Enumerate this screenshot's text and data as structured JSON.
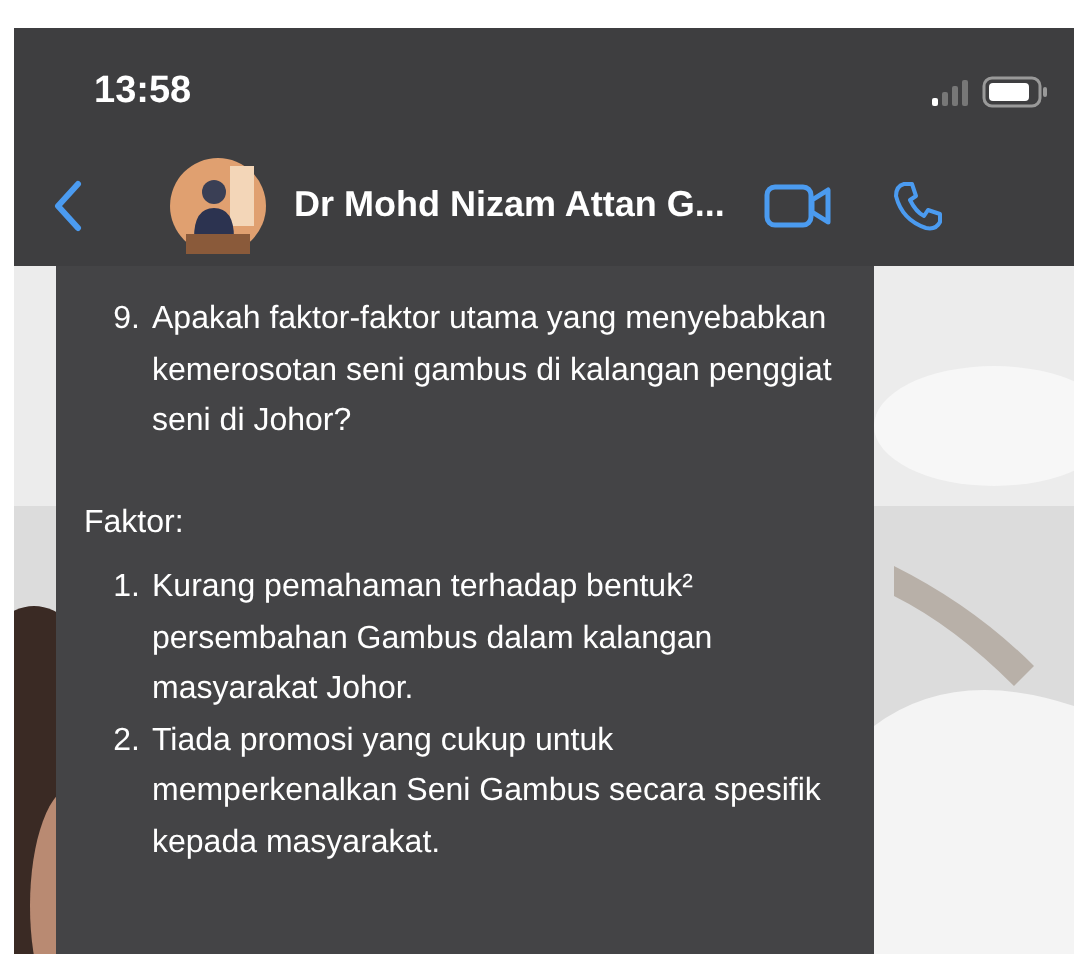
{
  "status_bar": {
    "time": "13:58"
  },
  "chat_header": {
    "contact_name": "Dr Mohd Nizam Attan G..."
  },
  "message": {
    "question": {
      "number": "9.",
      "text": "Apakah faktor-faktor utama yang menyebabkan kemerosotan seni gambus di kalangan penggiat seni di Johor?"
    },
    "heading": "Faktor:",
    "items": [
      {
        "number": "1.",
        "text": "Kurang pemahaman terhadap bentuk² persembahan Gambus dalam kalangan masyarakat Johor."
      },
      {
        "number": "2.",
        "text": "Tiada promosi yang cukup untuk memperkenalkan Seni Gambus secara spesifik kepada masyarakat."
      }
    ]
  }
}
